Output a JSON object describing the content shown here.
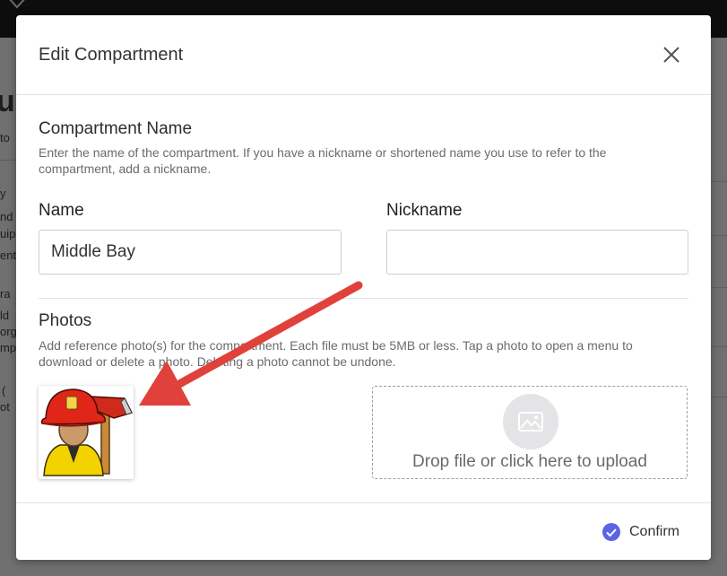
{
  "background": {
    "fragments": [
      {
        "text": "ur",
        "cls": "big"
      },
      {
        "text": "to"
      },
      {
        "text": "y"
      },
      {
        "text": "nd"
      },
      {
        "text": "uipi"
      },
      {
        "text": "ent"
      },
      {
        "text": "ra"
      },
      {
        "text": "ld"
      },
      {
        "text": "org"
      },
      {
        "text": "mp"
      },
      {
        "text": "("
      },
      {
        "text": "ot"
      }
    ]
  },
  "modal": {
    "title": "Edit Compartment",
    "close_icon": "close-icon",
    "compartment_name": {
      "title": "Compartment Name",
      "description": "Enter the name of the compartment. If you have a nickname or shortened name you use to refer to the compartment, add a nickname."
    },
    "name": {
      "label": "Name",
      "value": "Middle Bay",
      "placeholder": ""
    },
    "nickname": {
      "label": "Nickname",
      "value": "",
      "placeholder": ""
    },
    "photos": {
      "title": "Photos",
      "description": "Add reference photo(s) for the compartment. Each file must be 5MB or less. Tap a photo to open a menu to download or delete a photo. Deleting a photo cannot be undone.",
      "items": [
        {
          "icon": "firefighter-photo"
        }
      ],
      "upload_text": "Drop file or click here to upload",
      "upload_icon": "image-icon"
    },
    "confirm_label": "Confirm",
    "confirm_icon": "check-circle-icon",
    "accent_color": "#5b63e6",
    "annotation_color": "#e0413a"
  }
}
